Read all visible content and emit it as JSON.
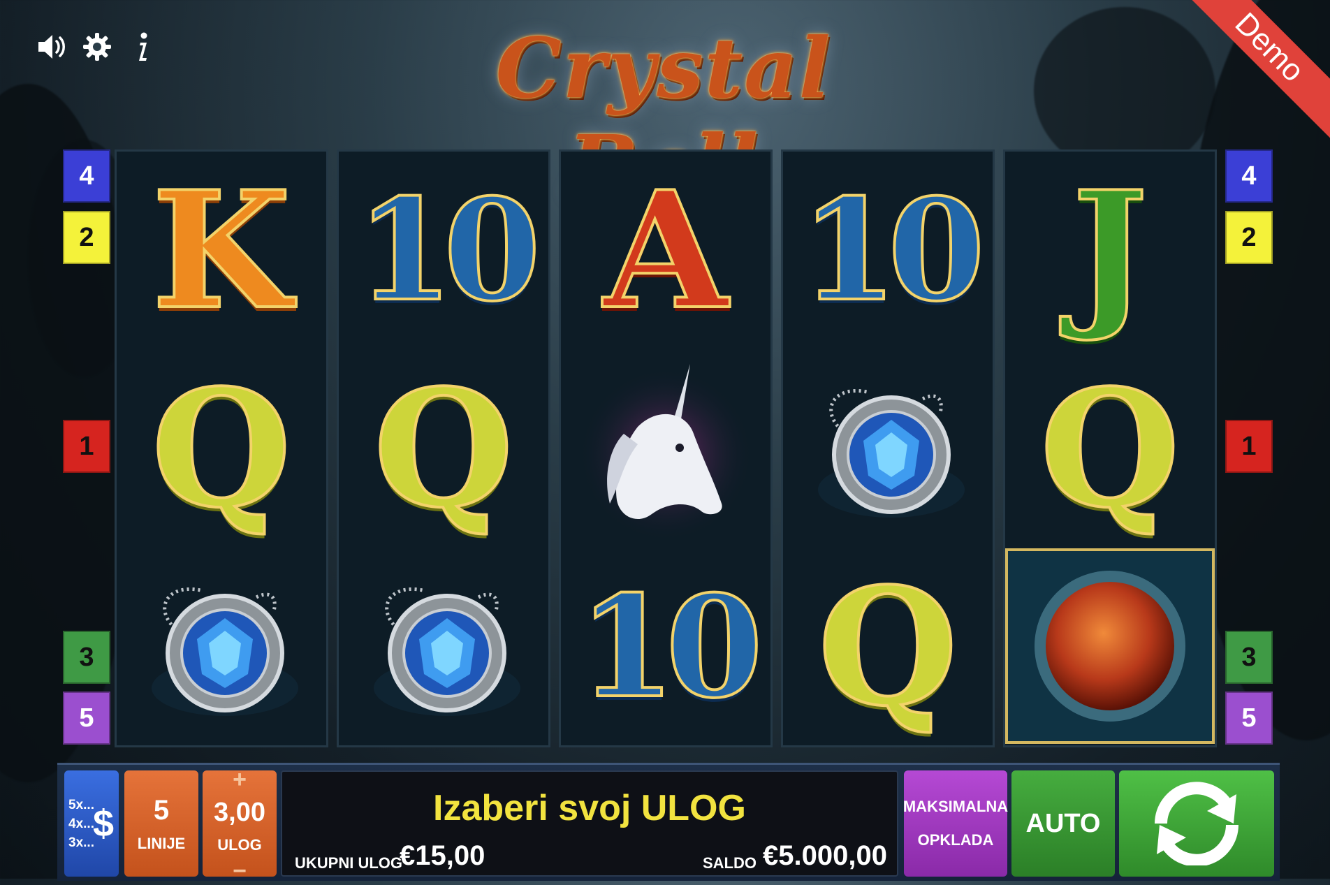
{
  "header": {
    "title": "Crystal Ball",
    "demo_label": "Demo",
    "icons": [
      "speaker-icon",
      "gear-icon",
      "info-icon"
    ]
  },
  "reels": [
    [
      "K",
      "Q",
      "amulet"
    ],
    [
      "10",
      "Q",
      "amulet"
    ],
    [
      "A",
      "unicorn",
      "10"
    ],
    [
      "10",
      "amulet",
      "Q"
    ],
    [
      "J",
      "Q",
      "crystal-ball"
    ]
  ],
  "paylines": {
    "left": [
      {
        "label": "4",
        "color": "#3b3fd6"
      },
      {
        "label": "2",
        "color": "#f4f23a"
      },
      {
        "label": "1",
        "color": "#d6241f"
      },
      {
        "label": "3",
        "color": "#3f9a45"
      },
      {
        "label": "5",
        "color": "#9b4fcf"
      }
    ],
    "right": [
      {
        "label": "4",
        "color": "#3b3fd6"
      },
      {
        "label": "2",
        "color": "#f4f23a"
      },
      {
        "label": "1",
        "color": "#d6241f"
      },
      {
        "label": "3",
        "color": "#3f9a45"
      },
      {
        "label": "5",
        "color": "#9b4fcf"
      }
    ]
  },
  "panel": {
    "paytable": {
      "lines": [
        "5x...",
        "4x...",
        "3x..."
      ],
      "symbol": "$"
    },
    "lines": {
      "value": "5",
      "label": "LINIJE"
    },
    "stake": {
      "value": "3,00",
      "label": "ULOG",
      "plus": "+",
      "minus": "−"
    },
    "message": "Izaberi svoj ULOG",
    "total_bet_label": "UKUPNI ULOG",
    "total_bet_value": "€15,00",
    "balance_label": "SALDO",
    "balance_value": "€5.000,00",
    "max_bet": [
      "MAKSIMALNA",
      "OPKLADA"
    ],
    "auto_label": "AUTO",
    "colors": {
      "orange": "#d9662a",
      "purple": "#a53fc4",
      "green": "#3f9c3a",
      "blue": "#2f6fd6",
      "message": "#f2e33f"
    }
  }
}
